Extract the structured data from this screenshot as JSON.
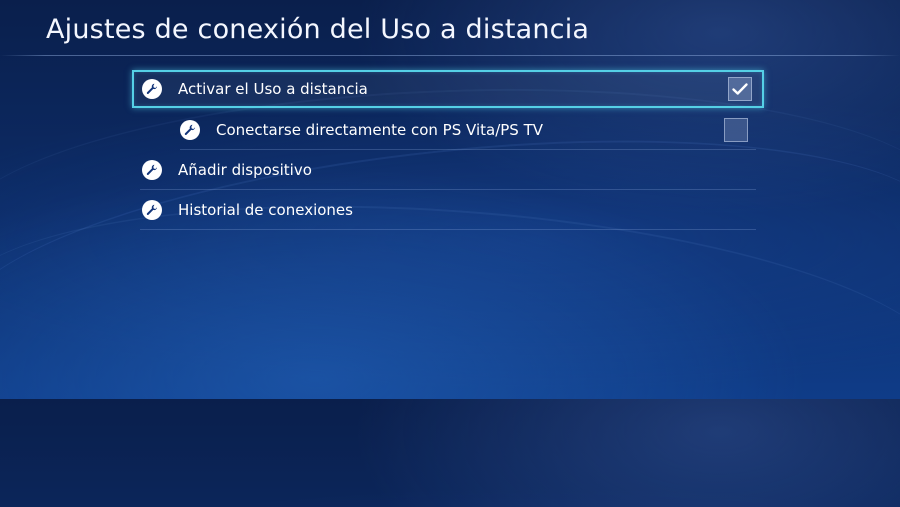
{
  "page": {
    "title": "Ajustes de conexión del Uso a distancia"
  },
  "menu": {
    "items": [
      {
        "label": "Activar el Uso a distancia",
        "icon": "wrench-icon",
        "checkbox": true,
        "checked": true,
        "selected": true
      },
      {
        "label": "Conectarse directamente con PS Vita/PS TV",
        "icon": "wrench-icon",
        "checkbox": true,
        "checked": false,
        "selected": false
      },
      {
        "label": "Añadir dispositivo",
        "icon": "wrench-icon",
        "checkbox": false
      },
      {
        "label": "Historial de conexiones",
        "icon": "wrench-icon",
        "checkbox": false
      }
    ]
  },
  "colors": {
    "background": "#0c2a63",
    "focus_outline": "#55d0e6",
    "text": "#ffffff"
  }
}
